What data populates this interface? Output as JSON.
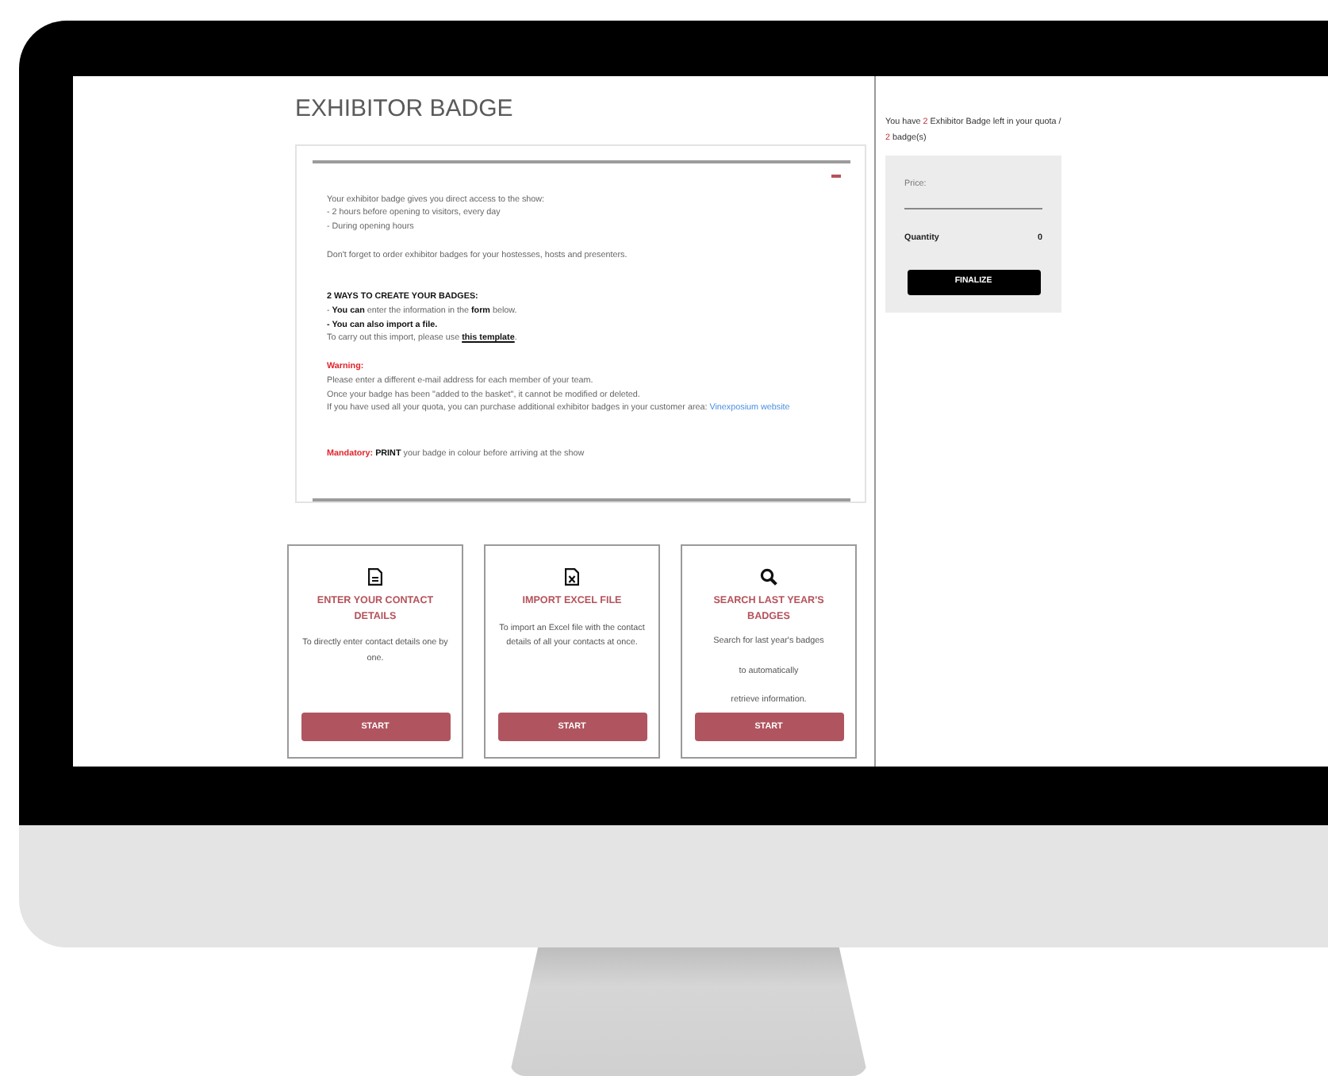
{
  "page_title": "EXHIBITOR BADGE",
  "info_panel": {
    "expanded": true,
    "blocks": [
      {
        "lines": [
          {
            "kind": "plain",
            "text": "Your exhibitor badge gives you direct access to the show:"
          },
          {
            "kind": "plain",
            "text": "- 2 hours before opening to visitors, every day"
          },
          {
            "kind": "plain",
            "text": "- During opening hours"
          }
        ]
      },
      {
        "lines": [
          {
            "kind": "plain",
            "text": "Don't forget to order exhibitor badges for your hostesses, hosts and presenters."
          }
        ]
      },
      {
        "lines": [
          {
            "kind": "heading",
            "text": "2 WAYS TO CREATE YOUR BADGES:"
          },
          {
            "kind": "plain",
            "text": "- **You can** enter the information in the **form** below."
          },
          {
            "kind": "plain",
            "text": "**- You can also import a file.**"
          },
          {
            "kind": "plain",
            "text": "To carry out this import, please use ",
            "link": {
              "kind": "template",
              "text": "this template"
            },
            "after": "."
          }
        ]
      },
      {
        "lines": [
          {
            "kind": "alert",
            "text": "Warning:"
          },
          {
            "kind": "plain",
            "text": "Please enter a different e-mail address for each member of your team."
          },
          {
            "kind": "plain",
            "text": "Once your badge has been \"added to the basket\", it cannot be modified or deleted."
          },
          {
            "kind": "plain",
            "text": "If you have used all your quota, you can purchase additional exhibitor badges in your customer area: ",
            "link": {
              "kind": "web",
              "text": "Vinexposium website"
            }
          }
        ]
      },
      {
        "lines": [
          {
            "kind": "plain",
            "label": "Mandatory:",
            "text": " **PRINT** your badge in colour before arriving at the show"
          }
        ]
      }
    ]
  },
  "cards": [
    {
      "kind": "document",
      "title": "ENTER YOUR CONTACT DETAILS",
      "description": [
        "To directly enter contact details one by one."
      ],
      "button": "START"
    },
    {
      "kind": "excel",
      "title": "IMPORT EXCEL FILE",
      "description": [
        "To import an Excel file with the contact details of all your contacts at once."
      ],
      "button": "START"
    },
    {
      "kind": "search",
      "title": "SEARCH LAST YEAR'S BADGES",
      "description": [
        "Search for last year's badges",
        "to automatically",
        "retrieve information."
      ],
      "button": "START"
    }
  ],
  "sidebar": {
    "quota": [
      {
        "text": "You have ",
        "highlight": false
      },
      {
        "text": "2",
        "highlight": true
      },
      {
        "text": " Exhibitor Badge left in your quota / ",
        "highlight": false
      },
      {
        "text": "2",
        "highlight": true
      },
      {
        "text": " badge(s)",
        "highlight": false
      }
    ],
    "price_label": "Price:",
    "quantity_label": "Quantity",
    "quantity_value": "0",
    "button": "FINALIZE"
  }
}
